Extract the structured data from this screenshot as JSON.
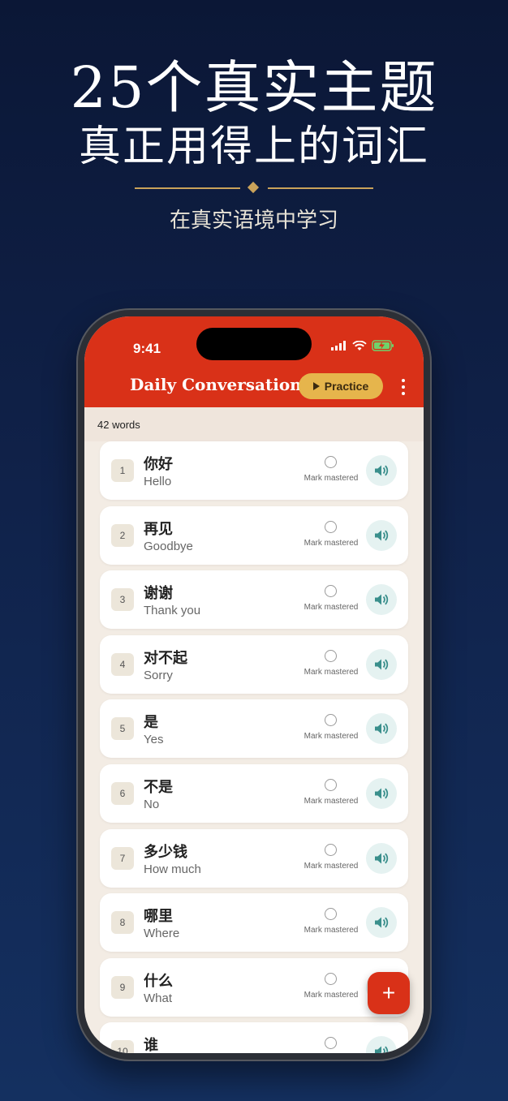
{
  "hero": {
    "title": "25个真实主题",
    "subtitle": "真正用得上的词汇",
    "tagline": "在真实语境中学习"
  },
  "status_bar": {
    "time": "9:41",
    "icons": [
      "signal-icon",
      "wifi-icon",
      "battery-charging-icon"
    ]
  },
  "header": {
    "title": "Daily Conversation",
    "practice_label": "Practice",
    "menu_icon": "more-vertical-icon",
    "color": "#d93118",
    "accent": "#e6b54c"
  },
  "word_count": "42 words",
  "mastered_label": "Mark mastered",
  "words": [
    {
      "num": "1",
      "zh": "你好",
      "en": "Hello"
    },
    {
      "num": "2",
      "zh": "再见",
      "en": "Goodbye"
    },
    {
      "num": "3",
      "zh": "谢谢",
      "en": "Thank you"
    },
    {
      "num": "4",
      "zh": "对不起",
      "en": "Sorry"
    },
    {
      "num": "5",
      "zh": "是",
      "en": "Yes"
    },
    {
      "num": "6",
      "zh": "不是",
      "en": "No"
    },
    {
      "num": "7",
      "zh": "多少钱",
      "en": "How much"
    },
    {
      "num": "8",
      "zh": "哪里",
      "en": "Where"
    },
    {
      "num": "9",
      "zh": "什么",
      "en": "What"
    },
    {
      "num": "10",
      "zh": "谁",
      "en": ""
    }
  ],
  "fab_label": "+"
}
